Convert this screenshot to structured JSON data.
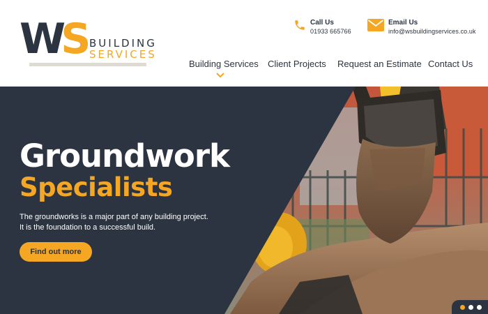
{
  "brand": {
    "mark_w": "W",
    "mark_s": "S",
    "line1": "BUILDING",
    "line2": "SERVICES"
  },
  "contact": {
    "call_title": "Call Us",
    "call_value": "01933 665766",
    "email_title": "Email Us",
    "email_value": "info@wsbuildingservices.co.uk",
    "call_icon": "phone-icon",
    "email_icon": "envelope-icon"
  },
  "nav": {
    "items": [
      {
        "label": "Building Services",
        "active": true
      },
      {
        "label": "Client Projects",
        "active": false
      },
      {
        "label": "Request an Estimate",
        "active": false
      },
      {
        "label": "Contact Us",
        "active": false
      }
    ]
  },
  "hero": {
    "title_line1": "Groundwork",
    "title_line2": "Specialists",
    "text_line1": "The groundworks is a major part of any building project.",
    "text_line2": "It is the foundation to a successful build.",
    "cta_label": "Find out more"
  },
  "slider": {
    "dot_count": 3,
    "active_index": 0
  },
  "colors": {
    "dark": "#2b3440",
    "accent": "#f5a623",
    "white": "#ffffff"
  }
}
